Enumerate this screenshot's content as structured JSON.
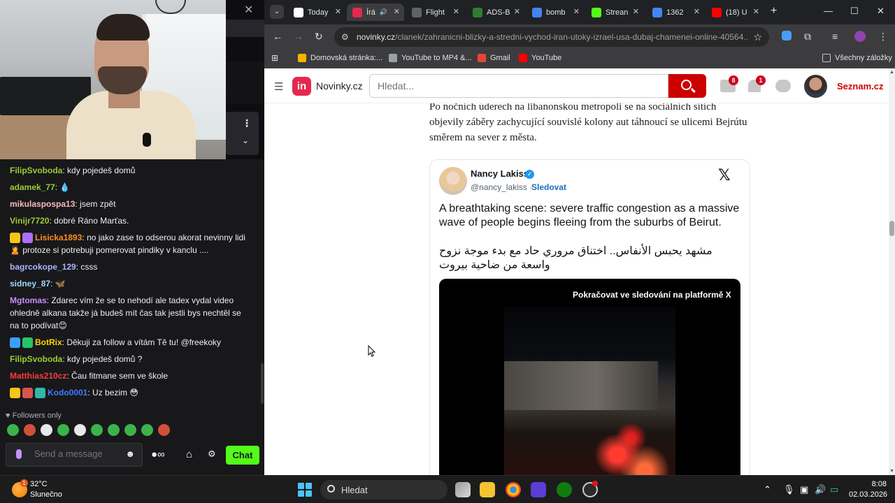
{
  "twitch": {
    "close": "✕",
    "messages": [
      {
        "user": "FilipSvoboda",
        "color": "#9acd32",
        "text": "kdy pojedeš domů",
        "badges": []
      },
      {
        "user": "adamek_77",
        "color": "#9acd32",
        "text": "💧",
        "badges": []
      },
      {
        "user": "mikulaspospa13",
        "color": "#ffb8b8",
        "text": "jsem zpět",
        "badges": []
      },
      {
        "user": "Vinijr7720",
        "color": "#9acd32",
        "text": "dobré Ráno Marťas.",
        "badges": []
      },
      {
        "user": "Lisicka1893",
        "color": "#ff8c1a",
        "text": "no jako zase to odserou akorat nevinny lidi 🙎 protoze si potrebuji pomerovat pindiky v kanclu ....",
        "badges": [
          "#f5c518",
          "#a970ff"
        ]
      },
      {
        "user": "bagrcokope_129",
        "color": "#aab4ff",
        "text": "csss",
        "badges": []
      },
      {
        "user": "sidney_87",
        "color": "#9ad7ff",
        "text": "🦋",
        "badges": []
      },
      {
        "user": "Mgtomas",
        "color": "#c78bff",
        "text": "Zdarec vím že se to nehodí ale tadex vydal video ohledně alkana takže já budeš mít čas tak jestli bys nechtěl se na to podívat😊",
        "badges": []
      },
      {
        "user": "BotRix",
        "color": "#ffd400",
        "text": "Děkuji za follow a vítám Tě tu! @freekoky",
        "badges": [
          "#3aa0ff",
          "#27c46b"
        ]
      },
      {
        "user": "FilipSvoboda",
        "color": "#9acd32",
        "text": "kdy pojedeš domů ?",
        "badges": []
      },
      {
        "user": "Matthias210cz",
        "color": "#ff3b3b",
        "text": "Čau fitmane sem ve škole",
        "badges": []
      },
      {
        "user": "Kodo0001",
        "color": "#3d7bff",
        "text": "Uz bezim 😳",
        "badges": [
          "#f5c518",
          "#d9534f",
          "#2fb8a8"
        ]
      }
    ],
    "followers_only": "Followers only",
    "input_placeholder": "Send a message",
    "chat_button": "Chat"
  },
  "chrome": {
    "tabs": [
      {
        "label": "Today",
        "fav": "#ffffff",
        "active": false
      },
      {
        "label": "Írá",
        "fav": "#e4284e",
        "active": true
      },
      {
        "label": "Flight",
        "fav": "#5f6368",
        "active": false
      },
      {
        "label": "ADS-B",
        "fav": "#2e7d32",
        "active": false
      },
      {
        "label": "bomb",
        "fav": "#4285f4",
        "active": false
      },
      {
        "label": "Strean",
        "fav": "#53fc18",
        "active": false
      },
      {
        "label": "1362",
        "fav": "#4285f4",
        "active": false
      },
      {
        "label": "(18) U",
        "fav": "#ff0000",
        "active": false
      }
    ],
    "url_host": "novinky.cz",
    "url_path": "/clanek/zahranicni-blizky-a-stredni-vychod-iran-utoky-izrael-usa-dubaj-chamenei-online-40564...",
    "bookmarks": [
      {
        "label": "Domovská stránka:...",
        "color": "#f5b400"
      },
      {
        "label": "YouTube to MP4 &...",
        "color": "#9aa0a6"
      },
      {
        "label": "Gmail",
        "color": "#ea4335"
      },
      {
        "label": "YouTube",
        "color": "#ff0000"
      }
    ],
    "all_bookmarks": "Všechny záložky"
  },
  "novinky": {
    "logo": "in",
    "name": "Novinky.cz",
    "search_placeholder": "Hledat...",
    "mail_count": "8",
    "notif_count": "1",
    "seznam": "Seznam.cz",
    "article_text": "Po nočních úderech na libanonskou metropoli se na sociálních sítích objevily záběry zachycující souvislé kolony aut táhnoucí se ulicemi Bejrútu směrem na sever z města."
  },
  "tweet": {
    "name": "Nancy Lakiss",
    "handle": "@nancy_lakiss",
    "separator": "·",
    "follow": "Sledovat",
    "text": "A breathtaking scene: severe traffic congestion as a massive wave of people begins fleeing from the suburbs of Beirut.",
    "text_ar": "مشهد يحبس الأنفاس.. اختناق مروري حاد مع بدء موجة نزوح واسعة من ضاحية بيروت",
    "video_cta": "Pokračovat ve sledování na platformě X"
  },
  "taskbar": {
    "temp": "32°C",
    "weather": "Slunečno",
    "weather_badge": "1",
    "search": "Hledat",
    "time": "8:08",
    "date": "02.03.2026"
  }
}
